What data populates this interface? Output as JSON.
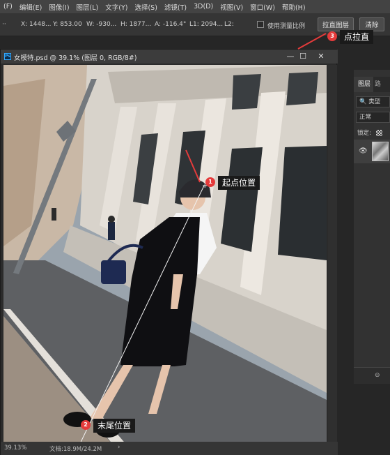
{
  "menubar": {
    "items": [
      "(F)",
      "编辑(E)",
      "图像(I)",
      "图层(L)",
      "文字(Y)",
      "选择(S)",
      "滤镜(T)",
      "3D(D)",
      "视图(V)",
      "窗口(W)",
      "帮助(H)"
    ]
  },
  "options": {
    "x": "X: 1448...",
    "y": "Y: 853.00",
    "w": "W: -930...",
    "h": "H: 1877...",
    "a": "A: -116.4°",
    "l1": "L1: 2094...",
    "l2": "L2:",
    "use_scale_label": "使用测量比例",
    "straighten_button": "拉直图层",
    "clear_button": "清除"
  },
  "document": {
    "title": "女模特.psd @ 39.1% (图层 0, RGB/8#)",
    "zoom": "39.13%",
    "doc_info": "文档:18.9M/24.2M",
    "minimize": "—",
    "restore": "☐",
    "close": "✕",
    "status_arrow": "›"
  },
  "panel": {
    "tab_layers": "图层",
    "tab_paths": "路",
    "kind_filter": "🔍 类型",
    "blend_mode": "正常",
    "lock_label": "锁定:",
    "eye": "👁",
    "bottom_icon": "⊖"
  },
  "callouts": {
    "c1_number": "1",
    "c1_text": "起点位置",
    "c2_number": "2",
    "c2_text": "末尾位置",
    "c3_number": "3",
    "c3_text": "点拉直"
  },
  "colors": {
    "accent_red": "#e53b3b",
    "ps_blue": "#31a8ff"
  }
}
